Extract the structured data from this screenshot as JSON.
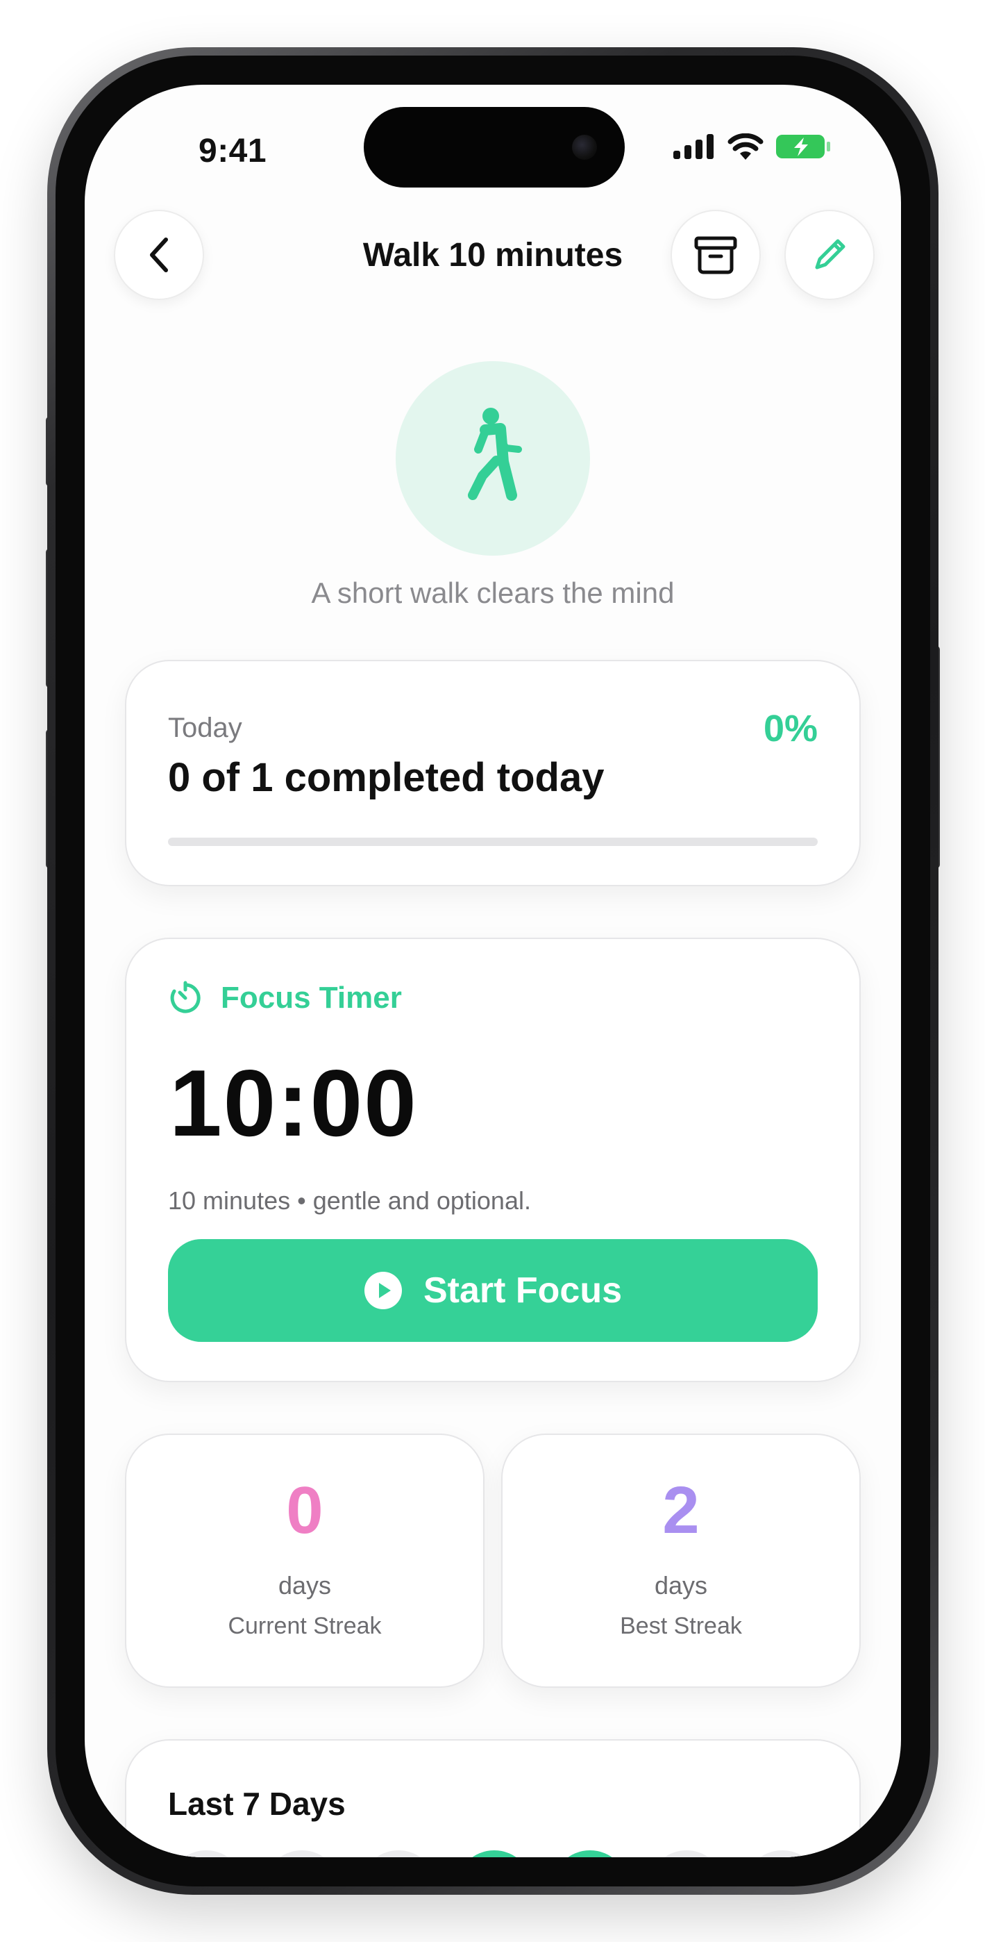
{
  "status_bar": {
    "time": "9:41",
    "icons": [
      "signal-icon",
      "wifi-icon",
      "battery-charging-icon"
    ],
    "battery_color": "#34c759"
  },
  "header": {
    "title": "Walk 10 minutes",
    "back_icon": "chevron-left-icon",
    "archive_icon": "archive-icon",
    "edit_icon": "pencil-icon"
  },
  "hero": {
    "icon": "walking-person-icon",
    "subtitle": "A short walk clears the mind"
  },
  "today": {
    "label": "Today",
    "percent": "0%",
    "progress_fraction": 0,
    "title": "0 of 1 completed today"
  },
  "focus": {
    "icon": "timer-icon",
    "label": "Focus Timer",
    "time": "10:00",
    "note": "10 minutes • gentle and optional.",
    "button_label": "Start Focus",
    "button_icon": "play-circle-icon"
  },
  "streaks": {
    "current": {
      "value": "0",
      "unit": "days",
      "caption": "Current Streak",
      "color": "#ef7fc4"
    },
    "best": {
      "value": "2",
      "unit": "days",
      "caption": "Best Streak",
      "color": "#a98ff0"
    }
  },
  "week": {
    "title": "Last 7 Days",
    "days": [
      {
        "done": false
      },
      {
        "done": false
      },
      {
        "done": false
      },
      {
        "done": true
      },
      {
        "done": true
      },
      {
        "done": false
      },
      {
        "done": false
      }
    ]
  },
  "colors": {
    "accent": "#34cf96",
    "hero_bg": "#e3f6ee"
  }
}
